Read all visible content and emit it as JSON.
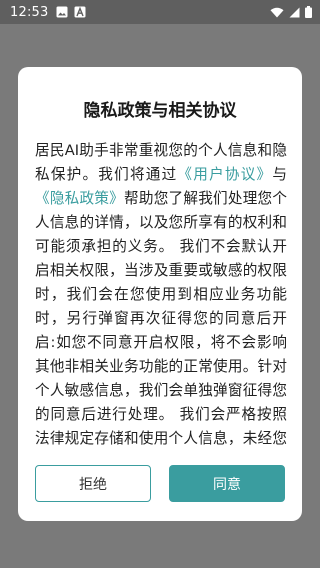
{
  "status_bar": {
    "time": "12:53",
    "notification_icons": [
      "image-icon",
      "a-letter-icon"
    ],
    "system_icons": [
      "wifi-icon",
      "signal-icon",
      "battery-icon"
    ]
  },
  "dialog": {
    "title": "隐私政策与相关协议",
    "body": {
      "intro": "居民AI助手非常重视您的个人信息和隐私保护。我们将通过",
      "user_agreement_link": "《用户协议》",
      "connector": "与",
      "privacy_policy_link": "《隐私政策》",
      "rest": "帮助您了解我们处理您个人信息的详情，以及您所享有的权利和可能须承担的义务。 我们不会默认开启相关权限，当涉及重要或敏感的权限时，我们会在您使用到相应业务功能时，另行弹窗再次征得您的同意后开启:如您不同意开启权限，将不会影响其他非相关业务功能的正常使用。针对个人敏感信息，我们会单独弹窗征得您的同意后进行处理。 我们会严格按照法律规定存储和使用个人信息，未经您的授权"
    },
    "buttons": {
      "reject": "拒绝",
      "agree": "同意"
    }
  },
  "colors": {
    "accent": "#3a9d9f",
    "overlay": "#7a7a7a",
    "status_bar": "#5f5f5f",
    "dialog_background": "#ffffff"
  }
}
